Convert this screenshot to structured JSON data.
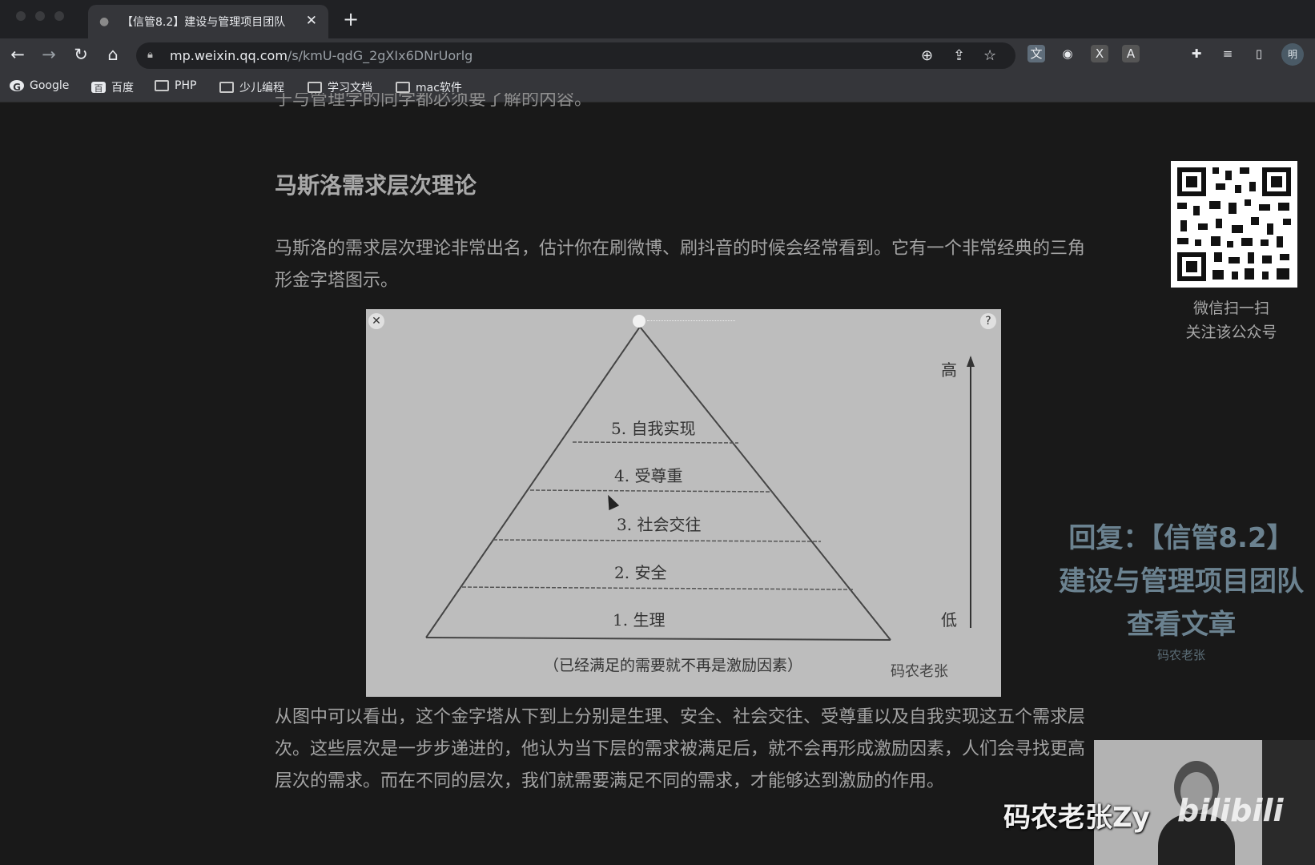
{
  "browser": {
    "tab": {
      "title": "【信管8.2】建设与管理项目团队",
      "favicon": "wechat-icon"
    },
    "new_tab": "+",
    "url": {
      "host": "mp.weixin.qq.com",
      "path": "/s/kmU-qdG_2gXIx6DNrUorlg"
    },
    "profile_initial": "明",
    "bookmarks": [
      {
        "label": "Google",
        "icon": "google-icon"
      },
      {
        "label": "百度",
        "icon": "baidu-icon"
      },
      {
        "label": "PHP",
        "icon": "folder-icon"
      },
      {
        "label": "少儿编程",
        "icon": "folder-icon"
      },
      {
        "label": "学习文档",
        "icon": "folder-icon"
      },
      {
        "label": "mac软件",
        "icon": "folder-icon"
      }
    ]
  },
  "article": {
    "cut_line": "于与管理学的同学都必须要了解的内容。",
    "heading": "马斯洛需求层次理论",
    "intro": "马斯洛的需求层次理论非常出名，估计你在刷微博、刷抖音的时候会经常看到。它有一个非常经典的三角形金字塔图示。",
    "body": "从图中可以看出，这个金字塔从下到上分别是生理、安全、社会交往、受尊重以及自我实现这五个需求层次。这些层次是一步步递进的，他认为当下层的需求被满足后，就不会再形成激励因素，人们会寻找更高层次的需求。而在不同的层次，我们就需要满足不同的需求，才能够达到激励的作用。"
  },
  "figure": {
    "levels": [
      "1. 生理",
      "2. 安全",
      "3. 社会交往",
      "4. 受尊重",
      "5. 自我实现"
    ],
    "axis_high": "高",
    "axis_low": "低",
    "caption": "（已经满足的需要就不再是激励因素）",
    "watermark": "码农老张",
    "close": "✕",
    "help": "?"
  },
  "sidebar": {
    "qr_line1": "微信扫一扫",
    "qr_line2": "关注该公众号"
  },
  "promo": {
    "line1": "回复：【信管8.2】",
    "line2": "建设与管理项目团队",
    "line3": "查看文章",
    "author": "码农老张"
  },
  "video": {
    "uploader": "码农老张Zy",
    "platform": "bilibili"
  }
}
